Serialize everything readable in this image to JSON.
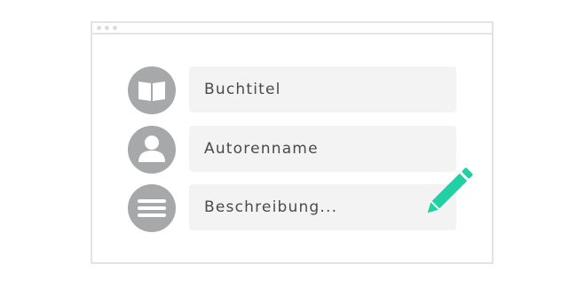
{
  "form": {
    "fields": [
      {
        "icon": "book-icon",
        "placeholder": "Buchtitel"
      },
      {
        "icon": "user-icon",
        "placeholder": "Autorenname"
      },
      {
        "icon": "text-lines-icon",
        "placeholder": "Beschreibung..."
      }
    ]
  },
  "decoration": {
    "icon": "pencil-icon"
  },
  "colors": {
    "icon_bg": "#a7a8a9",
    "field_bg": "#f3f3f3",
    "accent": "#1fd1a4",
    "border": "#e3e3e3",
    "text": "#4a4a4a"
  }
}
